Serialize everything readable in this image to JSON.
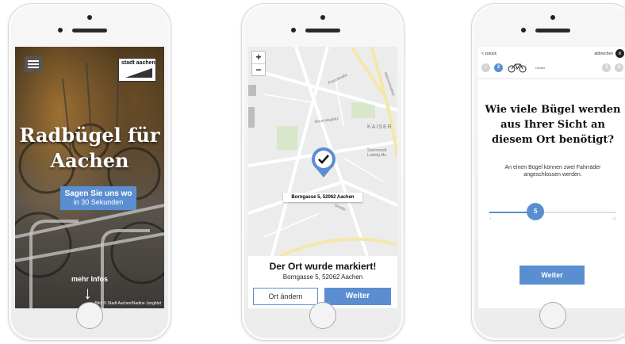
{
  "colors": {
    "accent": "#5b8ed1",
    "map_bg": "#ececec",
    "text": "#111111"
  },
  "phone1": {
    "menu_icon": "hamburger-icon",
    "logo_text": "stadt aachen",
    "title_line1": "Radbügel für",
    "title_line2": "Aachen",
    "cta_line1": "Sagen Sie uns wo",
    "cta_line2": "in 30 Sekunden",
    "more_label": "mehr Infos",
    "arrow_icon": "arrow-down-icon",
    "credit": "Bild: © Stadt Aachen/Nadine Jungblut"
  },
  "phone2": {
    "zoom_in": "+",
    "zoom_out": "−",
    "map_labels": [
      "Peterstraße",
      "Bourcatsplatz",
      "KAISER",
      "Suermondt Ludwig Mu",
      "Straße",
      "Heinrichsallee"
    ],
    "marker_icon": "checkmark-pin-icon",
    "address_label": "Borngasse 5, 52062 Aachen",
    "marked_title": "Der Ort wurde markiert!",
    "marked_address": "Borngasse 5, 52062 Aachen",
    "change_button": "Ort ändern",
    "next_button": "Weiter"
  },
  "phone3": {
    "back": "< zurück",
    "cancel": "abbrechen",
    "close_icon": "close-icon",
    "steps": [
      "✓",
      "2",
      "3",
      "4"
    ],
    "step_caption": "Details",
    "bike_icon": "bicycle-icon",
    "question_line1": "Wie viele Bügel werden",
    "question_line2": "aus Ihrer Sicht an",
    "question_line3": "diesem Ort benötigt?",
    "hint": "An einen Bügel können zwei Fahrräder angeschlossen werden.",
    "slider_value": 5,
    "slider_value_label": "5",
    "slider_min": 1,
    "slider_max": 12,
    "slider_min_label": "1",
    "slider_max_label": "12",
    "next_button": "Weiter"
  }
}
